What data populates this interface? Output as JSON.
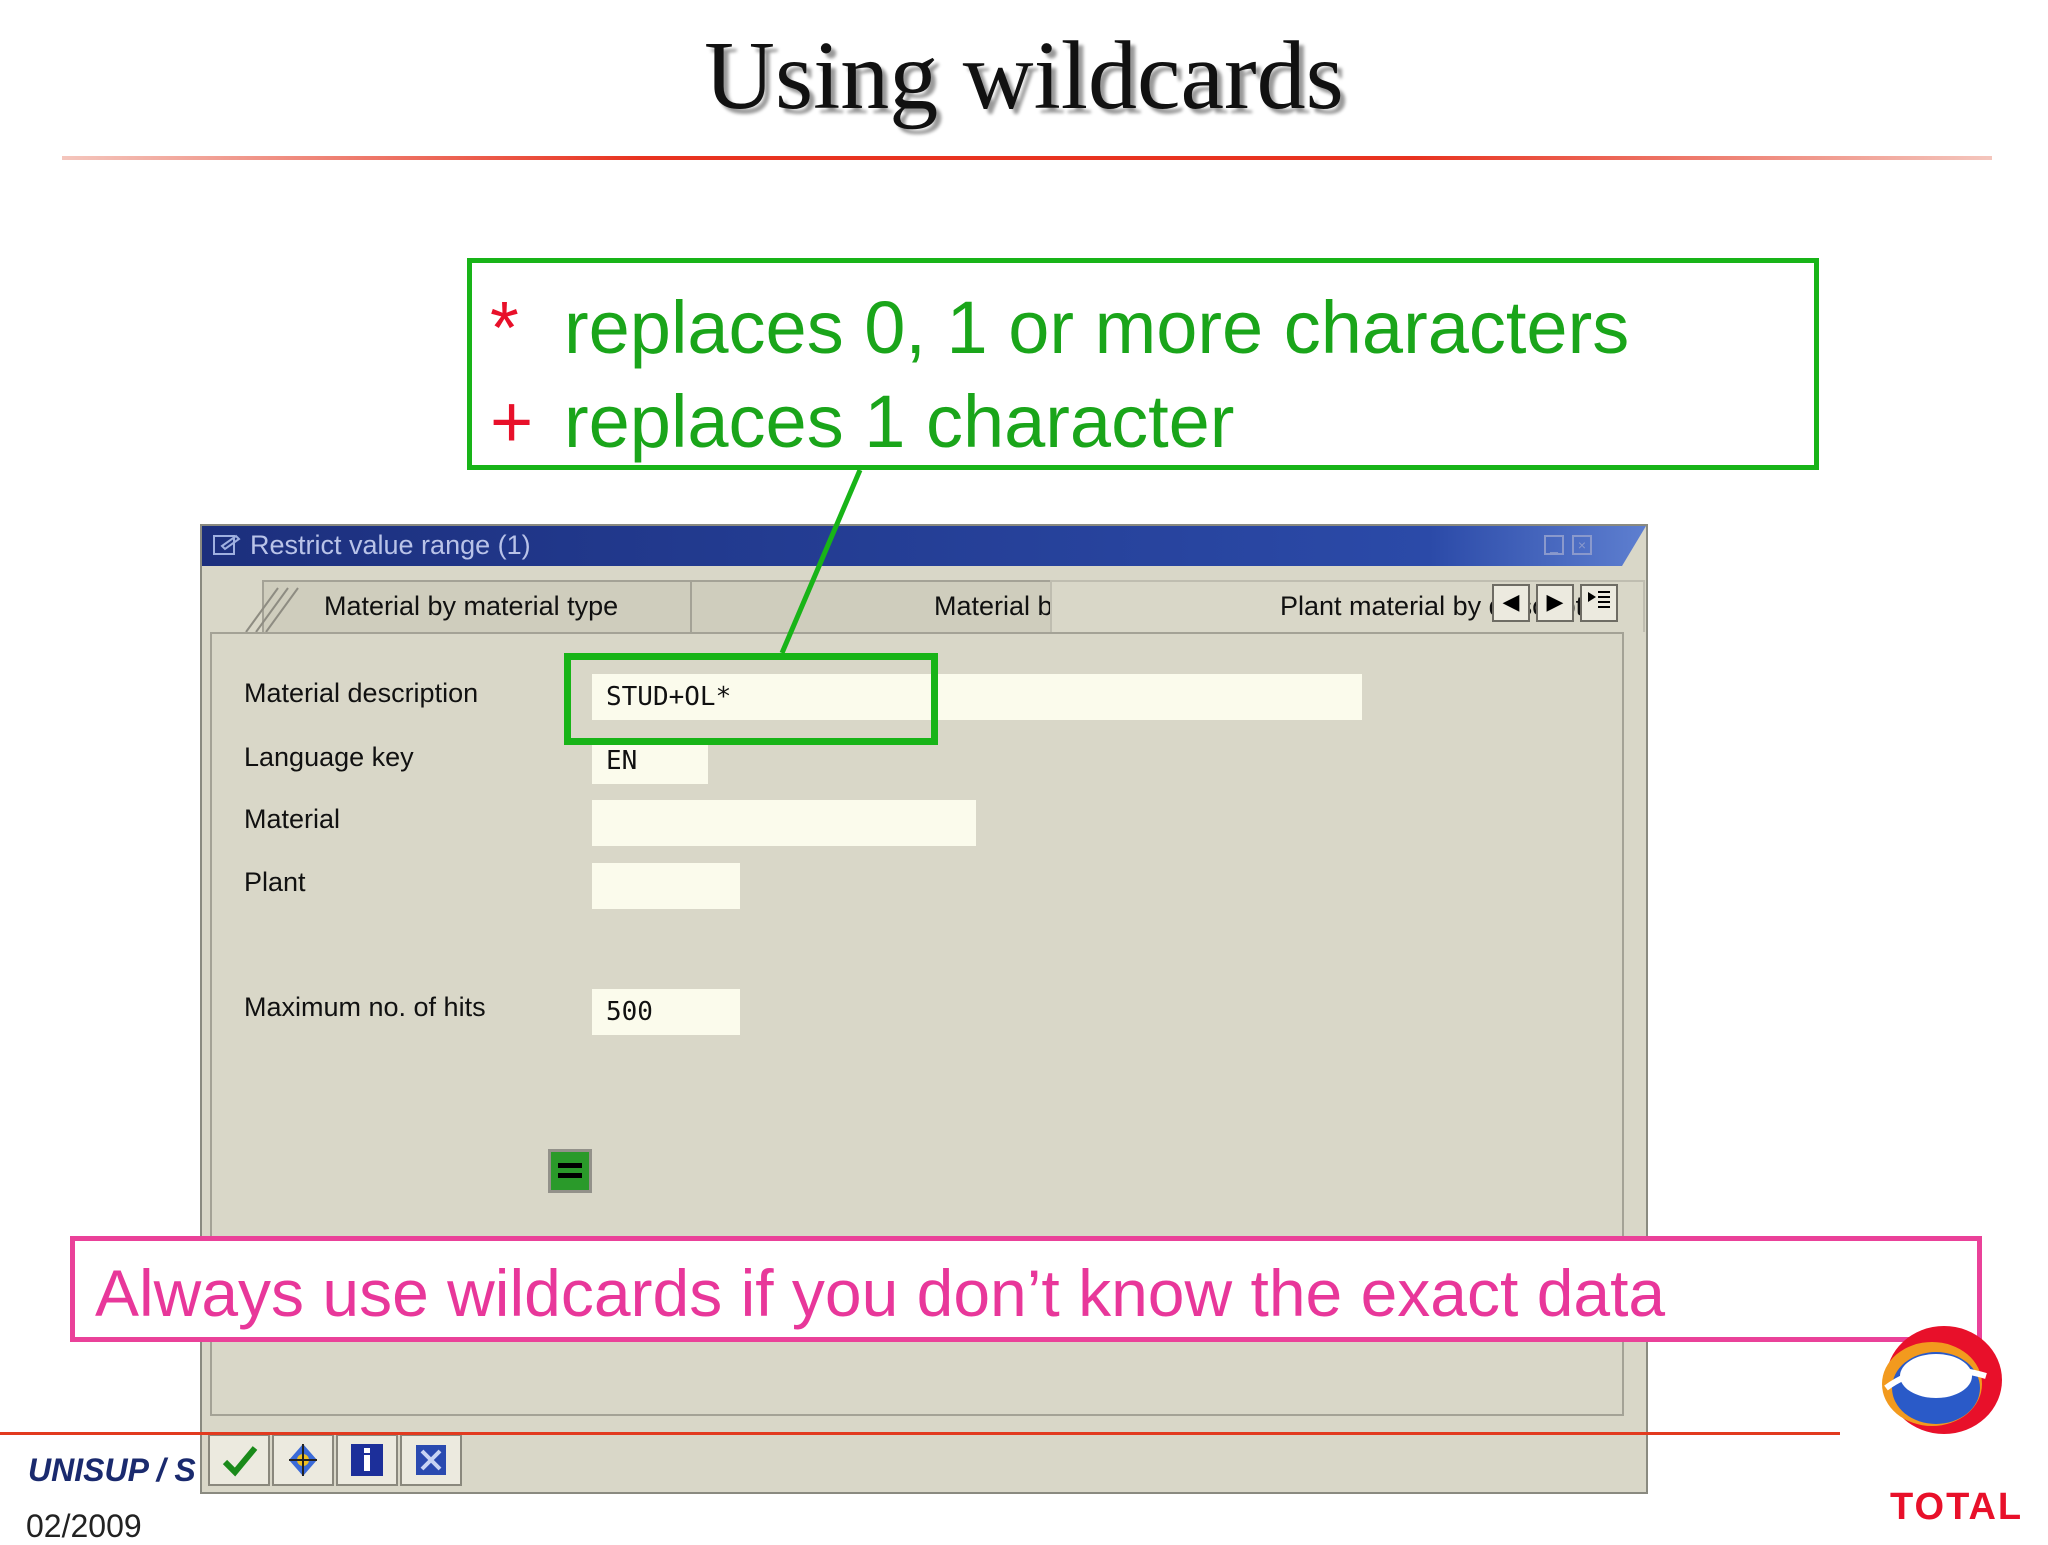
{
  "slide": {
    "title": "Using wildcards",
    "callout": {
      "line1_symbol": "*",
      "line1_text": "replaces 0, 1 or more characters",
      "line2_symbol": "+",
      "line2_text": "replaces 1 character"
    },
    "tip": "Always use wildcards if you don’t know the exact data",
    "footer": {
      "org": "UNISUP / S",
      "date": "02/2009",
      "logo_text": "TOTAL"
    }
  },
  "dialog": {
    "title": "Restrict value range (1)",
    "tabs": [
      {
        "label": "Material by material type",
        "active": false
      },
      {
        "label": "Material by Supply Area",
        "active": false
      },
      {
        "label": "Plant material by description",
        "active": true
      }
    ],
    "fields": {
      "material_description": {
        "label": "Material description",
        "value": "STUD+OL*"
      },
      "language_key": {
        "label": "Language key",
        "value": "EN"
      },
      "material": {
        "label": "Material",
        "value": ""
      },
      "plant": {
        "label": "Plant",
        "value": ""
      },
      "max_hits": {
        "label": "Maximum no. of hits",
        "value": "500"
      }
    },
    "toolbar_icons": [
      "checkmark-icon",
      "multiple-selection-icon",
      "info-icon",
      "cancel-icon"
    ]
  },
  "colors": {
    "callout_green": "#18b418",
    "wildcard_red": "#e8102a",
    "tip_pink": "#e8379a",
    "sap_titlebar": "#1c2f7d",
    "sap_background": "#d9d7c8"
  }
}
